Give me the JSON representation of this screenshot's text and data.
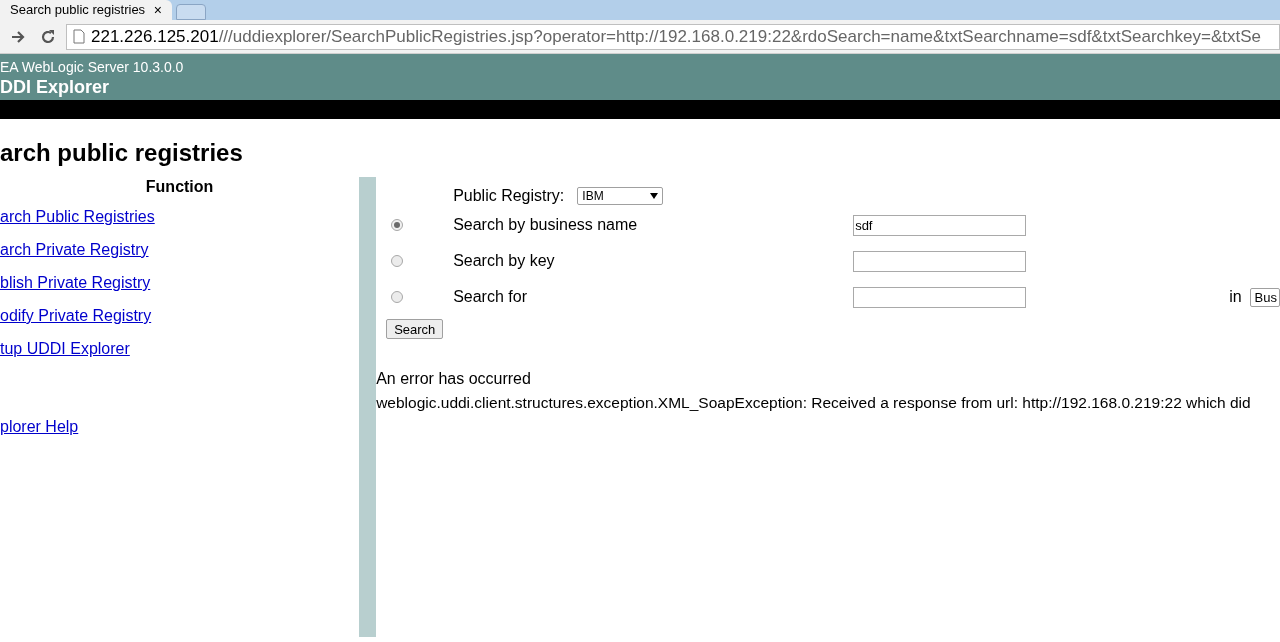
{
  "browser": {
    "tab": {
      "title": "Search public registries",
      "close": "×"
    },
    "address": {
      "host": "221.226.125.201",
      "path": "///uddiexplorer/SearchPublicRegistries.jsp?operator=http://192.168.0.219:22&rdoSearch=name&txtSearchname=sdf&txtSearchkey=&txtSe"
    }
  },
  "header": {
    "product": "EA WebLogic Server 10.3.0.0",
    "title": "DDI Explorer"
  },
  "page_title": "arch public registries",
  "sidebar": {
    "heading": "Function",
    "links": [
      {
        "label": "arch Public Registries"
      },
      {
        "label": "arch Private Registry"
      },
      {
        "label": "blish Private Registry"
      },
      {
        "label": "odify Private Registry"
      },
      {
        "label": "tup UDDI Explorer"
      }
    ],
    "help_link": "plorer Help"
  },
  "form": {
    "registry_label": "Public Registry:",
    "registry_value": "IBM",
    "options": [
      {
        "label": "Search by business name",
        "selected": true,
        "value": "sdf"
      },
      {
        "label": "Search by key",
        "selected": false
      },
      {
        "label": "Search for",
        "selected": false,
        "scope": {
          "label": "in",
          "value": "Bus"
        }
      }
    ],
    "button": "Search"
  },
  "error": {
    "title": "An error has occurred",
    "message": "weblogic.uddi.client.structures.exception.XML_SoapException: Received a response from url: http://192.168.0.219:22 which did"
  }
}
